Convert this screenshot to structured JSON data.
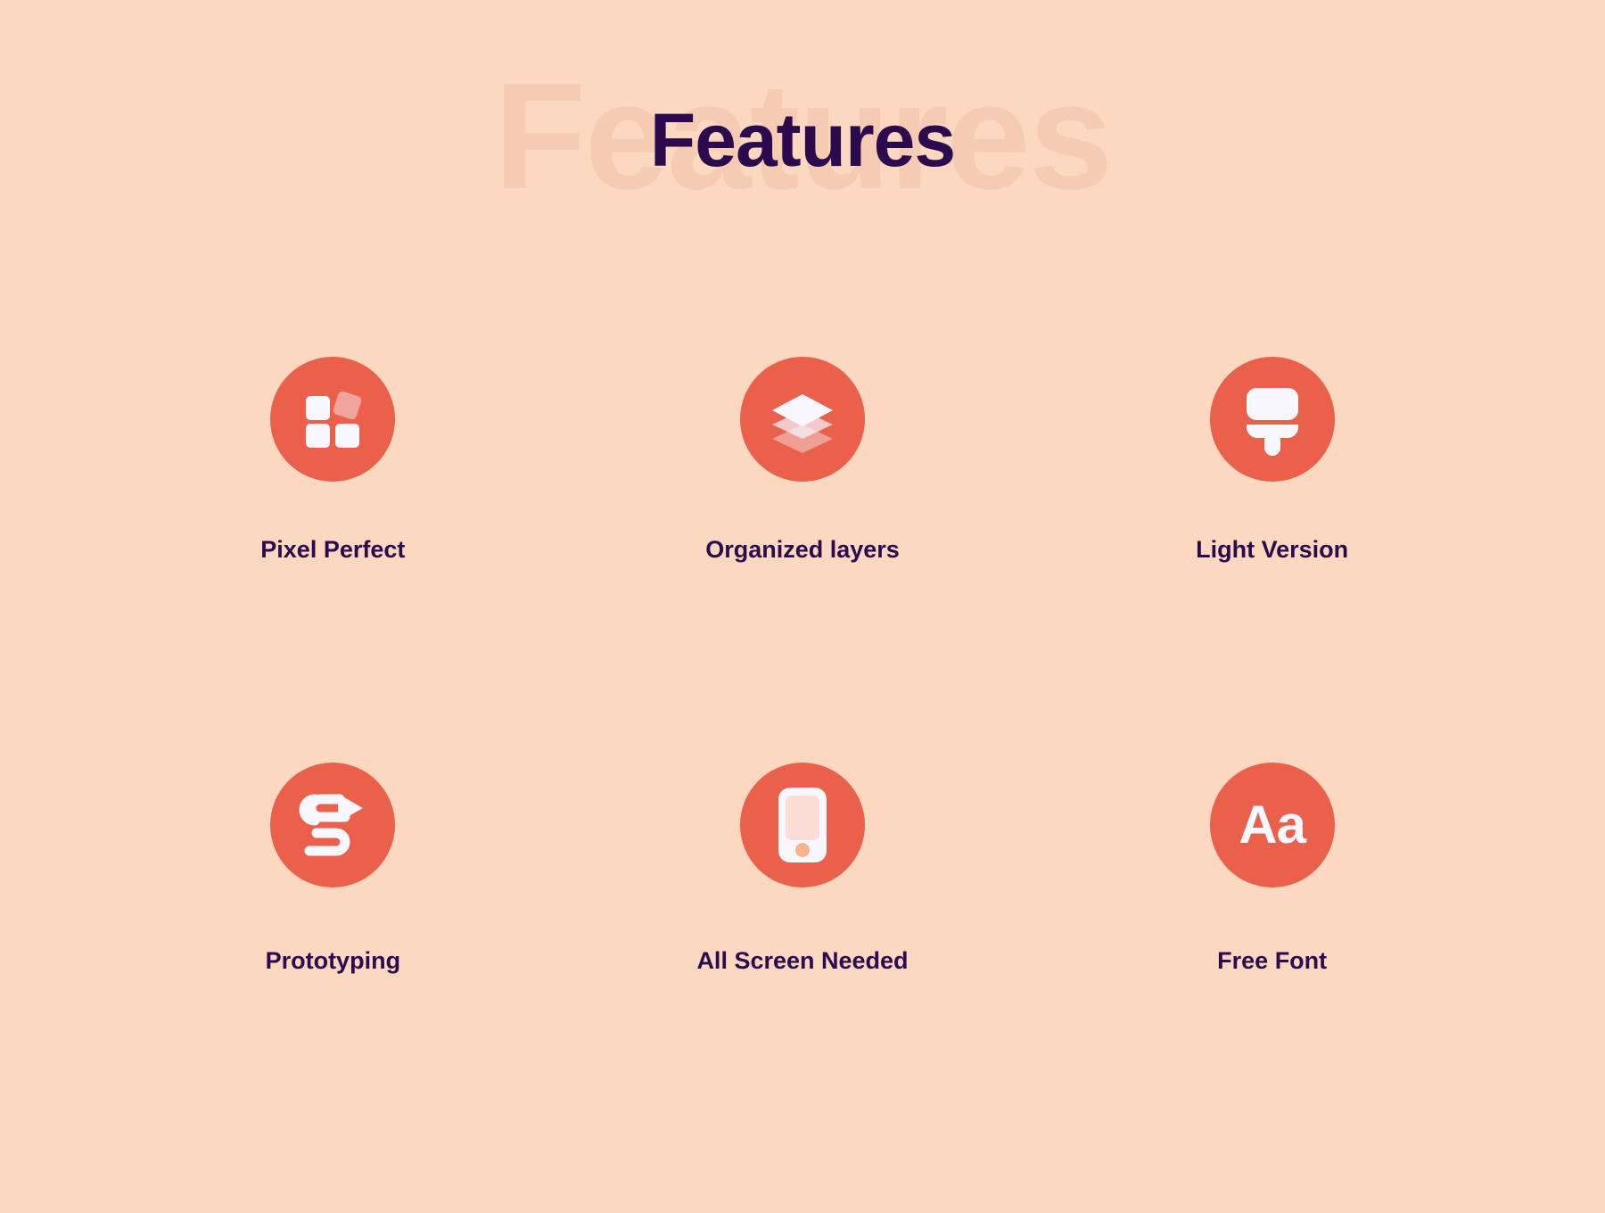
{
  "page": {
    "background_color": "#FCD8C0",
    "accent_color": "#EA604B",
    "text_color": "#2B0A4D",
    "watermark_color": "#F6CBB4",
    "icon_fill": "#F9F7FF"
  },
  "header": {
    "title": "Features",
    "watermark": "Features"
  },
  "features": [
    {
      "label": "Pixel Perfect",
      "icon": "grid-squares-icon"
    },
    {
      "label": "Organized layers",
      "icon": "layers-stack-icon"
    },
    {
      "label": "Light Version",
      "icon": "paint-brush-icon"
    },
    {
      "label": "Prototyping",
      "icon": "flow-arrow-icon"
    },
    {
      "label": "All Screen Needed",
      "icon": "mobile-phone-icon"
    },
    {
      "label": "Free Font",
      "icon": "typography-aa-icon"
    }
  ],
  "icon_glyphs": {
    "typography_text": "Aa"
  }
}
